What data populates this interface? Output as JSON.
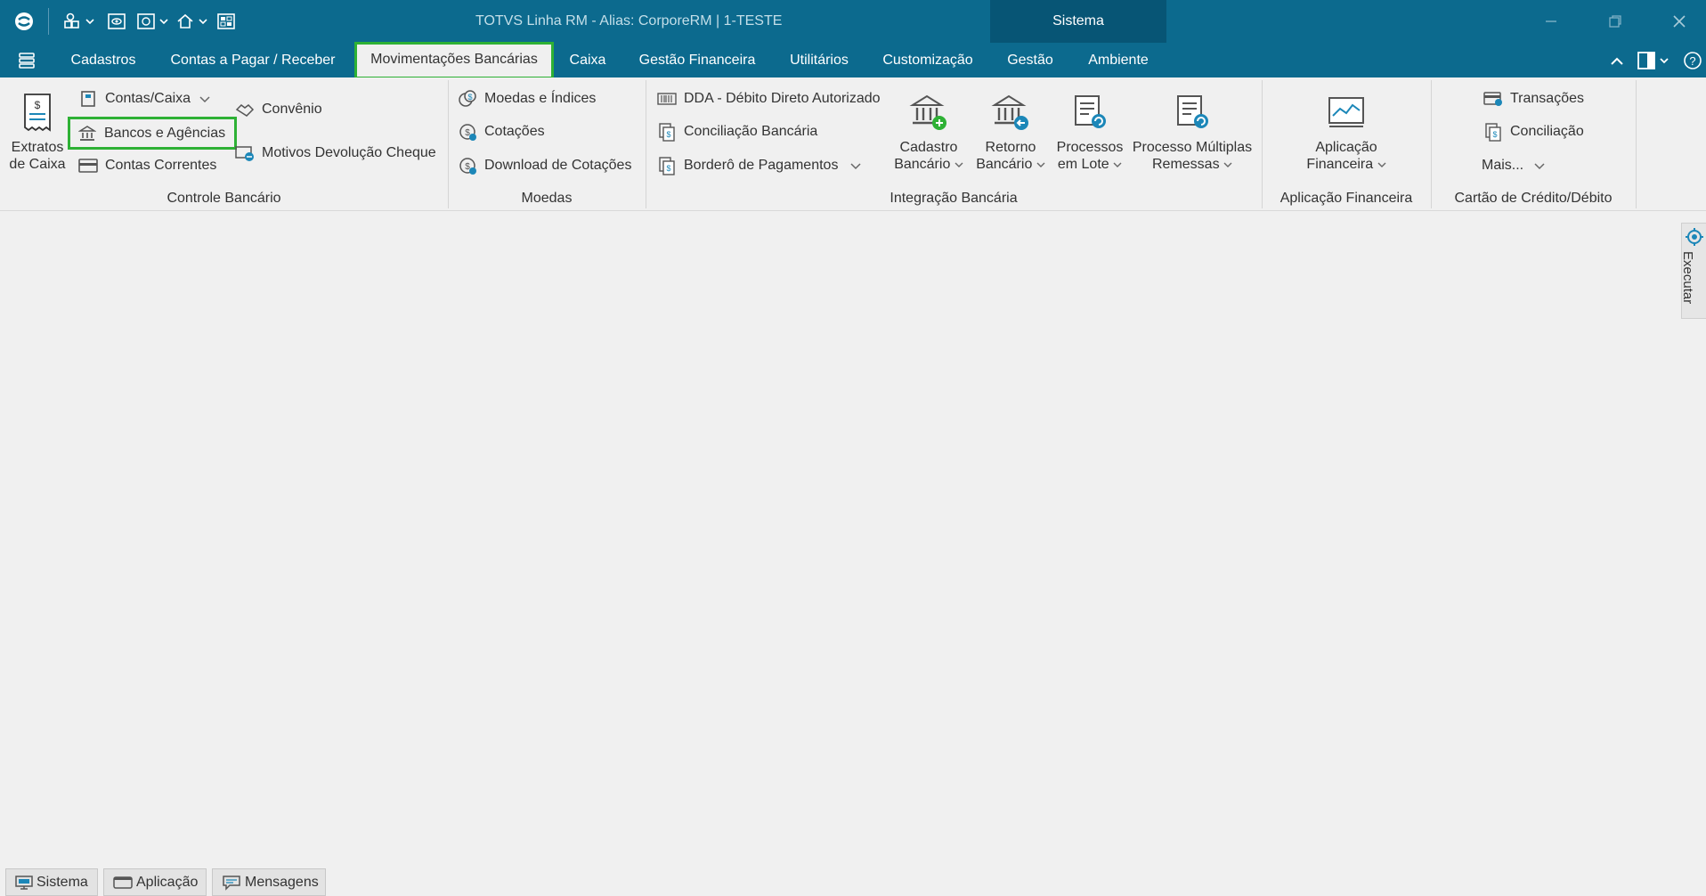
{
  "window": {
    "title": "TOTVS Linha RM -  Alias: CorporeRM | 1-TESTE",
    "sistema_label": "Sistema"
  },
  "menu": {
    "tabs": [
      {
        "label": "Cadastros"
      },
      {
        "label": "Contas a Pagar / Receber"
      },
      {
        "label": "Movimentações Bancárias",
        "active": true
      },
      {
        "label": "Caixa"
      },
      {
        "label": "Gestão Financeira"
      },
      {
        "label": "Utilitários"
      },
      {
        "label": "Customização"
      },
      {
        "label": "Gestão"
      },
      {
        "label": "Ambiente"
      }
    ]
  },
  "ribbon": {
    "controle_bancario": {
      "label": "Controle Bancário",
      "extratos": "Extratos\nde Caixa",
      "extratos_line1": "Extratos",
      "extratos_line2": "de Caixa",
      "contas_caixa": "Contas/Caixa",
      "bancos_agencias": "Bancos e Agências",
      "contas_correntes": "Contas Correntes",
      "convenio": "Convênio",
      "motivos_devolucao": "Motivos Devolução Cheque"
    },
    "moedas": {
      "label": "Moedas",
      "moedas_indices": "Moedas e Índices",
      "cotacoes": "Cotações",
      "download_cotacoes": "Download de Cotações"
    },
    "integracao": {
      "label": "Integração Bancária",
      "dda": "DDA - Débito Direto Autorizado",
      "conciliacao": "Conciliação Bancária",
      "bordero": "Borderô de Pagamentos",
      "cadastro_l1": "Cadastro",
      "cadastro_l2": "Bancário",
      "retorno_l1": "Retorno",
      "retorno_l2": "Bancário",
      "processos_l1": "Processos",
      "processos_l2": "em Lote",
      "multiplas_l1": "Processo Múltiplas",
      "multiplas_l2": "Remessas"
    },
    "aplicacao": {
      "label": "Aplicação Financeira",
      "btn_l1": "Aplicação",
      "btn_l2": "Financeira"
    },
    "cartao": {
      "label": "Cartão de Crédito/Débito",
      "transacoes": "Transações",
      "conciliacao": "Conciliação",
      "mais": "Mais..."
    }
  },
  "side_panel": {
    "executar": "Executar"
  },
  "bottom_tabs": [
    {
      "label": "Sistema",
      "icon": "monitor-icon"
    },
    {
      "label": "Aplicação",
      "icon": "window-icon"
    },
    {
      "label": "Mensagens",
      "icon": "message-icon"
    }
  ],
  "colors": {
    "titlebar": "#0c6a8e",
    "sistema_area": "#075575",
    "highlight": "#2eb135",
    "icon_blue": "#1c87b8"
  }
}
